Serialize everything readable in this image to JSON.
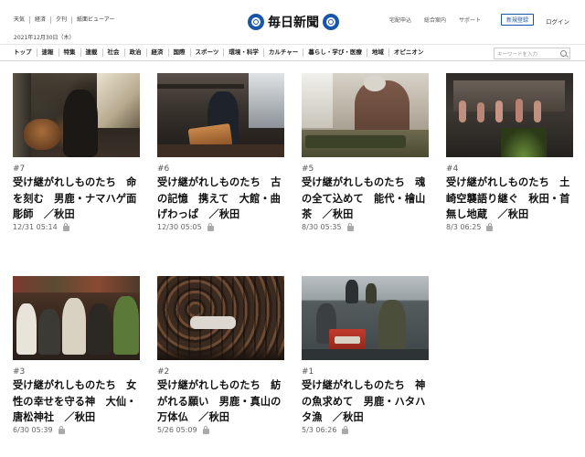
{
  "header": {
    "util_links": [
      "天気",
      "経済",
      "夕刊",
      "紙面ビューアー"
    ],
    "date": "2021年12月30日（木）",
    "logo_text": "毎日新聞",
    "right_links": [
      "宅配申込",
      "総合案内",
      "サポート"
    ],
    "register_label": "新規登録",
    "login_label": "ログイン"
  },
  "nav": {
    "items": [
      "トップ",
      "速報",
      "特集",
      "連載",
      "社会",
      "政治",
      "経済",
      "国際",
      "スポーツ",
      "環境・科学",
      "カルチャー",
      "暮らし・学び・医療",
      "地域",
      "オピニオン"
    ],
    "search_placeholder": "キーワードを入力"
  },
  "articles": [
    {
      "num": "#7",
      "title": "受け継がれしものたち　命を刻む　男鹿・ナマハゲ面彫師　／秋田",
      "date": "12/31 05:14"
    },
    {
      "num": "#6",
      "title": "受け継がれしものたち　古の記憶　携えて　大館・曲げわっぱ　／秋田",
      "date": "12/30 05:05"
    },
    {
      "num": "#5",
      "title": "受け継がれしものたち　魂の全て込めて　能代・檜山茶　／秋田",
      "date": "8/30 05:35"
    },
    {
      "num": "#4",
      "title": "受け継がれしものたち　土崎空襲語り継ぐ　秋田・首無し地蔵　／秋田",
      "date": "8/3 06:25"
    },
    {
      "num": "#3",
      "title": "受け継がれしものたち　女性の幸せを守る神　大仙・唐松神社　／秋田",
      "date": "6/30 05:39"
    },
    {
      "num": "#2",
      "title": "受け継がれしものたち　紡がれる願い　男鹿・真山の万体仏　／秋田",
      "date": "5/26 05:09"
    },
    {
      "num": "#1",
      "title": "受け継がれしものたち　神の魚求めて　男鹿・ハタハタ漁　／秋田",
      "date": "5/3 06:26"
    }
  ],
  "colors": {
    "brand": "#1a56a8",
    "text": "#111111",
    "muted": "#666666"
  }
}
